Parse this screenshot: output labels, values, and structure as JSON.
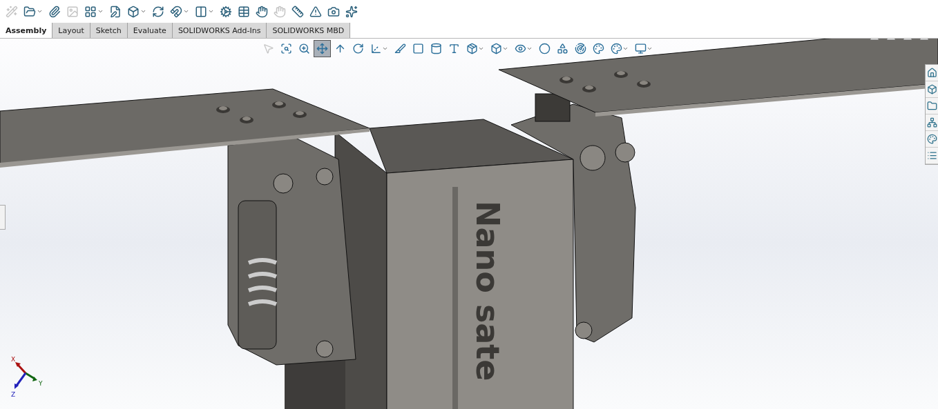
{
  "toolbar": [
    {
      "disabled": true,
      "dropdown": false
    },
    {
      "disabled": false,
      "dropdown": true
    },
    {
      "disabled": false,
      "dropdown": false
    },
    {
      "disabled": true,
      "dropdown": false
    },
    {
      "disabled": false,
      "dropdown": true
    },
    {
      "disabled": false,
      "dropdown": false
    },
    {
      "disabled": false,
      "dropdown": true
    },
    {
      "disabled": false,
      "dropdown": false
    },
    {
      "disabled": false,
      "dropdown": true
    },
    {
      "disabled": false,
      "dropdown": true
    },
    {
      "disabled": false,
      "dropdown": false
    },
    {
      "disabled": false,
      "dropdown": false
    },
    {
      "disabled": false,
      "dropdown": false
    },
    {
      "disabled": true,
      "dropdown": false
    },
    {
      "disabled": false,
      "dropdown": false
    },
    {
      "disabled": false,
      "dropdown": false
    },
    {
      "disabled": false,
      "dropdown": false
    },
    {
      "disabled": false,
      "dropdown": false
    }
  ],
  "tabs": [
    {
      "label": "Assembly",
      "selected": true
    },
    {
      "label": "Layout",
      "selected": false
    },
    {
      "label": "Sketch",
      "selected": false
    },
    {
      "label": "Evaluate",
      "selected": false
    },
    {
      "label": "SOLIDWORKS Add-Ins",
      "selected": false
    },
    {
      "label": "SOLIDWORKS MBD",
      "selected": false
    }
  ],
  "view_toolbar": [
    {
      "disabled": true,
      "selected": false,
      "dropdown": false
    },
    {
      "disabled": false,
      "selected": false,
      "dropdown": false
    },
    {
      "disabled": false,
      "selected": false,
      "dropdown": false
    },
    {
      "disabled": false,
      "selected": true,
      "dropdown": false
    },
    {
      "disabled": false,
      "selected": false,
      "dropdown": false
    },
    {
      "disabled": false,
      "selected": false,
      "dropdown": false
    },
    {
      "disabled": false,
      "selected": false,
      "dropdown": true
    },
    {
      "disabled": false,
      "selected": false,
      "dropdown": false
    },
    {
      "disabled": false,
      "selected": false,
      "dropdown": false
    },
    {
      "disabled": false,
      "selected": false,
      "dropdown": false
    },
    {
      "disabled": false,
      "selected": false,
      "dropdown": false
    },
    {
      "disabled": false,
      "selected": false,
      "dropdown": true
    },
    {
      "disabled": false,
      "selected": false,
      "dropdown": true
    },
    {
      "disabled": false,
      "selected": false,
      "dropdown": true
    },
    {
      "disabled": false,
      "selected": false,
      "dropdown": false
    },
    {
      "disabled": false,
      "selected": false,
      "dropdown": false
    },
    {
      "disabled": false,
      "selected": false,
      "dropdown": false
    },
    {
      "disabled": false,
      "selected": false,
      "dropdown": false
    },
    {
      "disabled": false,
      "selected": false,
      "dropdown": true
    },
    {
      "disabled": false,
      "selected": false,
      "dropdown": true
    }
  ],
  "model": {
    "engraved_text": "Nano sate"
  },
  "triad": {
    "x_label": "X",
    "y_label": "Y",
    "z_label": "Z"
  }
}
